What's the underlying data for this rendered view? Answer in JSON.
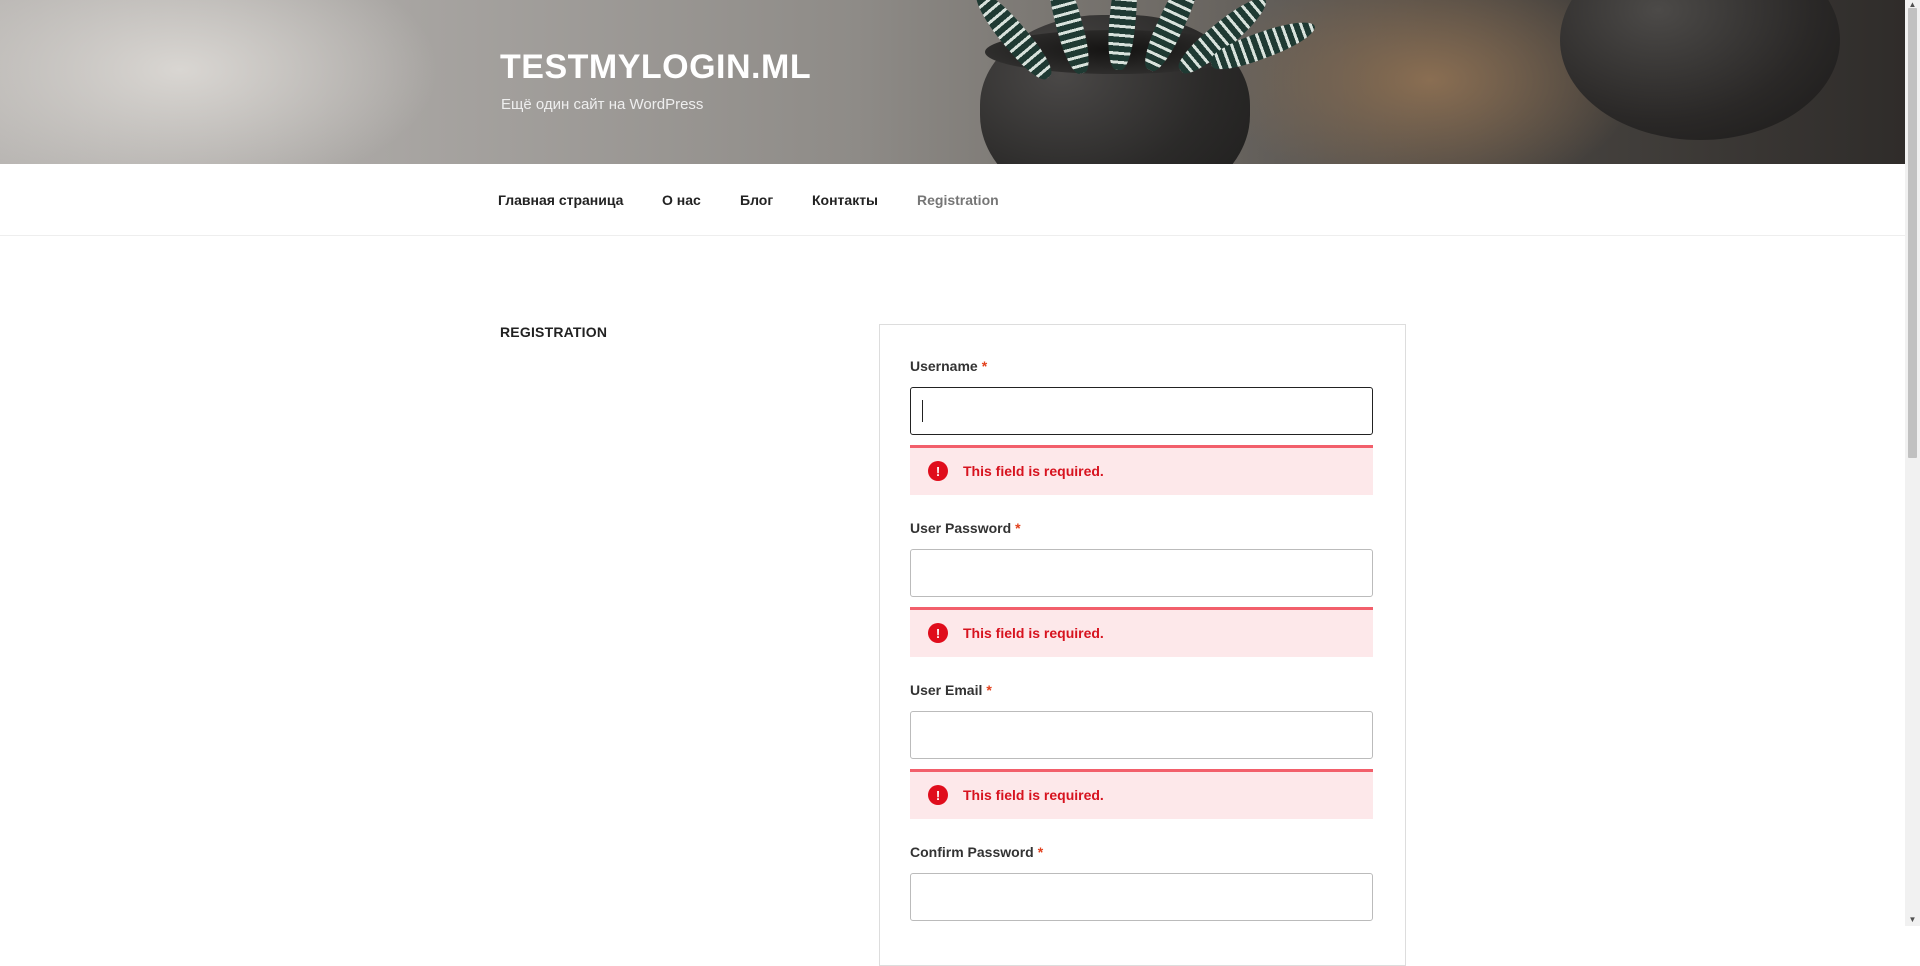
{
  "site": {
    "title": "TESTMYLOGIN.ML",
    "description": "Ещё один сайт на WordPress"
  },
  "nav": {
    "items": [
      {
        "label": "Главная страница"
      },
      {
        "label": "О нас"
      },
      {
        "label": "Блог"
      },
      {
        "label": "Контакты"
      },
      {
        "label": "Registration",
        "current": true
      }
    ]
  },
  "page": {
    "title": "REGISTRATION"
  },
  "form": {
    "required_mark": "*",
    "fields": [
      {
        "label": "Username",
        "value": "",
        "error": "This field is required."
      },
      {
        "label": "User Password",
        "value": "",
        "error": "This field is required."
      },
      {
        "label": "User Email",
        "value": "",
        "error": "This field is required."
      },
      {
        "label": "Confirm Password",
        "value": ""
      }
    ],
    "error_icon_glyph": "!"
  },
  "colors": {
    "error_text": "#d7131f",
    "error_bg": "#fde8ea",
    "error_border": "#f25f6b",
    "required": "#e2401c"
  }
}
